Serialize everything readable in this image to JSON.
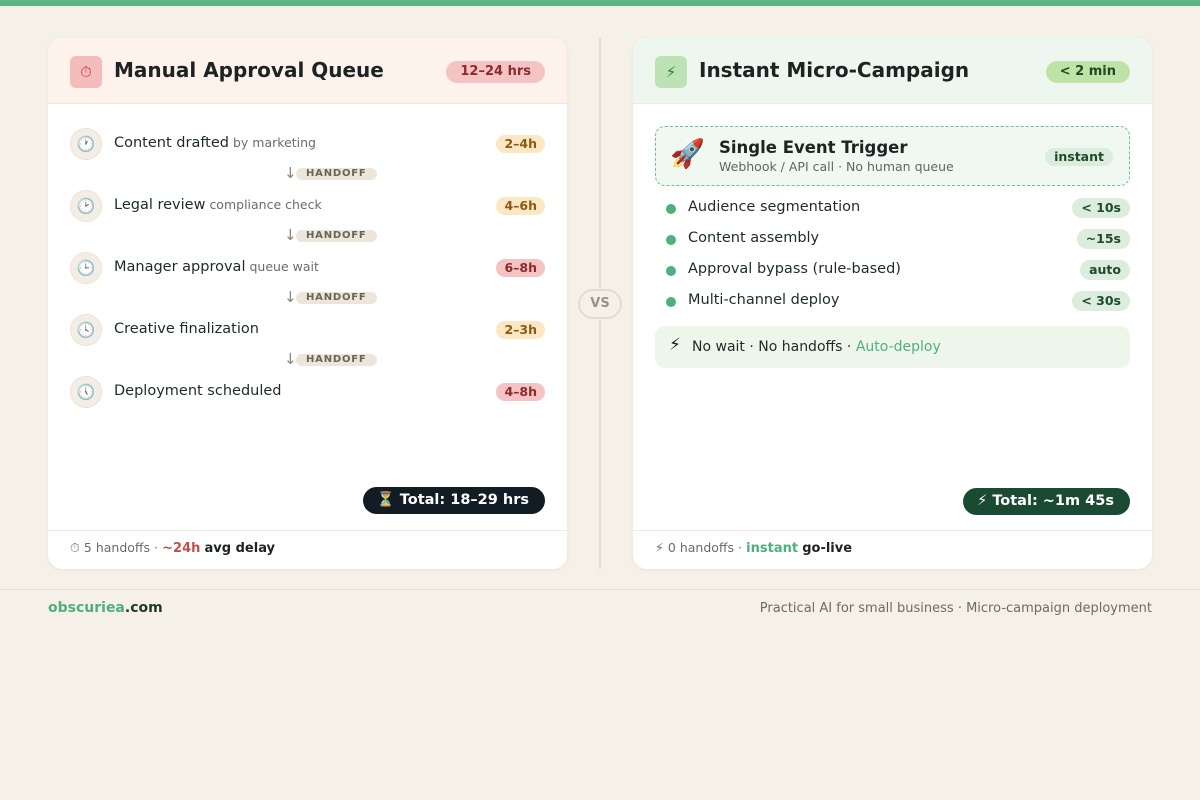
{
  "colors": {
    "accent_green": "#4fb07c",
    "accent_red": "#c0504d",
    "background": "#f5f1e8",
    "dark": "#121c24"
  },
  "left": {
    "icon": "stopwatch-icon",
    "icon_glyph": "⏱",
    "title": "Manual Approval Queue",
    "badge": "12–24 hrs",
    "steps": [
      {
        "icon_glyph": "🕐",
        "label": "Content drafted",
        "sub": "by marketing",
        "time": "2–4h"
      },
      {
        "icon_glyph": "🕑",
        "label": "Legal review",
        "sub": "compliance check",
        "time": "4–6h"
      },
      {
        "icon_glyph": "🕒",
        "label": "Manager approval",
        "sub": "queue wait",
        "time": "6–8h"
      },
      {
        "icon_glyph": "🕓",
        "label": "Creative finalization",
        "sub": "",
        "time": "2–3h"
      },
      {
        "icon_glyph": "🕔",
        "label": "Deployment scheduled",
        "sub": "",
        "time": "4–8h"
      }
    ],
    "handoff_arrow": "↓",
    "handoff_label": "HANDOFF",
    "total_icon": "⏳",
    "total": "Total: 18–29 hrs",
    "footer": {
      "icon": "⏱",
      "handoffs": "5 handoffs ·",
      "delay_value": "~24h",
      "delay_label": "avg delay"
    }
  },
  "vs": "VS",
  "right": {
    "icon": "lightning-icon",
    "icon_glyph": "⚡",
    "title": "Instant Micro-Campaign",
    "badge": "< 2 min",
    "trigger": {
      "icon_glyph": "🚀",
      "title": "Single Event Trigger",
      "sub": "Webhook / API call · No human queue",
      "badge": "instant"
    },
    "features": [
      {
        "label": "Audience segmentation",
        "time": "< 10s"
      },
      {
        "label": "Content assembly",
        "time": "~15s"
      },
      {
        "label": "Approval bypass (rule-based)",
        "time": "auto"
      },
      {
        "label": "Multi-channel deploy",
        "time": "< 30s"
      }
    ],
    "note": {
      "icon_glyph": "⚡",
      "text": "No wait · No handoffs ·",
      "link": "Auto-deploy"
    },
    "total_icon": "⚡",
    "total": "Total: ~1m 45s",
    "footer": {
      "icon": "⚡",
      "handoffs": "0 handoffs ·",
      "golive_value": "instant",
      "golive_label": "go-live"
    }
  },
  "page_footer": {
    "brand_a": "obscuriea",
    "brand_b": ".com",
    "tagline": "Practical AI for small business · Micro-campaign deployment"
  }
}
